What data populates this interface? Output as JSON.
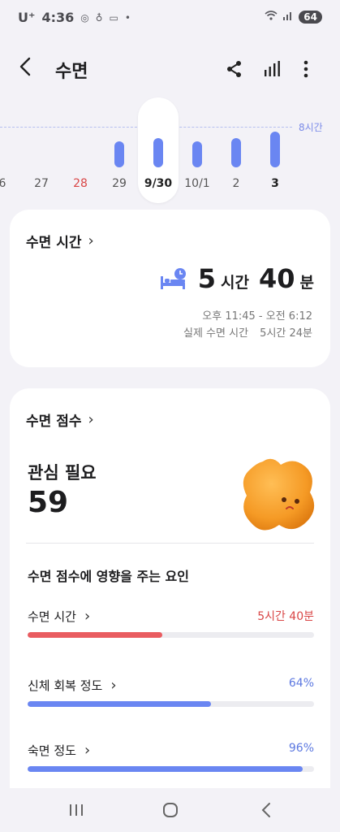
{
  "status": {
    "carrier": "U⁺",
    "time": "4:36",
    "battery": "64"
  },
  "header": {
    "title": "수면"
  },
  "timeline": {
    "max_label": "8시간",
    "days": [
      {
        "label": "6",
        "hours": 0,
        "kind": "normal"
      },
      {
        "label": "27",
        "hours": 0,
        "kind": "normal"
      },
      {
        "label": "28",
        "hours": 0,
        "kind": "weekend"
      },
      {
        "label": "29",
        "hours": 5.1,
        "kind": "normal"
      },
      {
        "label": "9/30",
        "hours": 5.7,
        "kind": "selected"
      },
      {
        "label": "10/1",
        "hours": 5.1,
        "kind": "normal"
      },
      {
        "label": "2",
        "hours": 5.7,
        "kind": "normal"
      },
      {
        "label": "3",
        "hours": 7.0,
        "kind": "today"
      }
    ]
  },
  "sleep_time": {
    "heading": "수면 시간",
    "hours": "5",
    "hours_unit": "시간",
    "minutes": "40",
    "minutes_unit": "분",
    "range": "오후 11:45 - 오전 6:12",
    "actual_label": "실제 수면 시간",
    "actual_value": "5시간 24분"
  },
  "sleep_score": {
    "heading": "수면 점수",
    "status": "관심 필요",
    "score": "59",
    "factors_title": "수면 점수에 영향을 주는 요인",
    "factors": [
      {
        "label": "수면 시간",
        "value": "5시간 40분",
        "ratio": 0.47,
        "color": "#e95c60",
        "value_color": "#d94646"
      },
      {
        "label": "신체 회복 정도",
        "value": "64%",
        "ratio": 0.64,
        "color": "#6a86f2",
        "value_color": "#5c78e0"
      },
      {
        "label": "숙면 정도",
        "value": "96%",
        "ratio": 0.96,
        "color": "#6a86f2",
        "value_color": "#5c78e0"
      }
    ]
  },
  "colors": {
    "accent": "#6a86f2",
    "alert": "#e95c60",
    "blob": "#f7a83a"
  }
}
